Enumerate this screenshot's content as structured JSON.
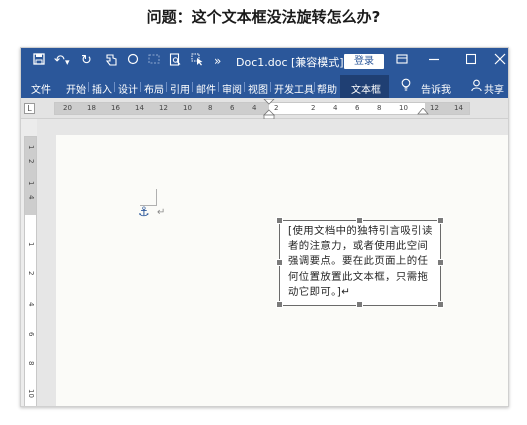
{
  "question": "问题：这个文本框没法旋转怎么办?",
  "titlebar": {
    "doc_title": "Doc1.doc [兼容模式]...",
    "login_label": "登录",
    "more_glyph": "»"
  },
  "menu": {
    "items": [
      "文件",
      "开始",
      "插入",
      "设计",
      "布局",
      "引用",
      "邮件",
      "审阅",
      "视图",
      "开发工具",
      "帮助",
      "文本框"
    ],
    "active": "文本框",
    "tell_me": "告诉我",
    "share": "共享"
  },
  "ruler": {
    "tabstop_glyph": "L",
    "numbers": [
      "20",
      "18",
      "16",
      "14",
      "12",
      "10",
      "8",
      "6",
      "4",
      "2",
      "2",
      "4",
      "6",
      "8",
      "10",
      "12",
      "14"
    ],
    "vertical_numbers": [
      "1",
      "2",
      "1",
      "4",
      "1",
      "2",
      "4",
      "6",
      "8",
      "10"
    ]
  },
  "textbox": {
    "text": "[使用文档中的独特引言吸引读者的注意力，或者使用此空间强调要点。要在此页面上的任何位置放置此文本框，只需拖动它即可。]↵"
  },
  "paragraph_mark": "↵",
  "icons": [
    "save-icon",
    "undo-icon",
    "redo-icon",
    "touch-icon",
    "circle-icon",
    "print-preview-icon",
    "select-icon",
    "more-icon",
    "ribbon-display-icon",
    "minimize-icon",
    "maximize-icon",
    "close-icon",
    "lightbulb-icon",
    "user-icon",
    "anchor-icon"
  ]
}
